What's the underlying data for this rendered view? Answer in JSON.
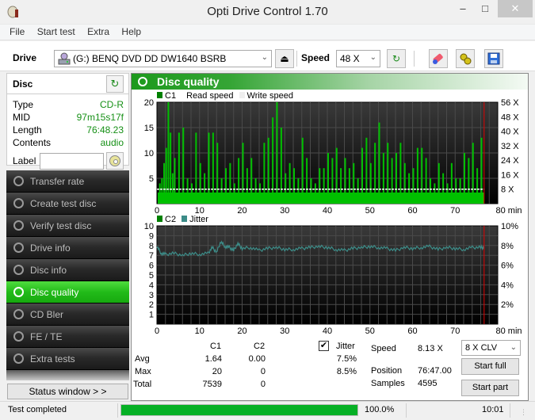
{
  "window": {
    "title": "Opti Drive Control 1.70",
    "controls": {
      "minimize": "–",
      "maximize": "□",
      "close": "✕"
    }
  },
  "menu": [
    "File",
    "Start test",
    "Extra",
    "Help"
  ],
  "toolbar": {
    "drive_label": "Drive",
    "drive_value": "(G:)   BENQ DVD DD DW1640 BSRB",
    "speed_label": "Speed",
    "speed_value": "48 X",
    "icons": [
      "drive-icon",
      "eject-icon",
      "refresh-icon",
      "eraser-icon",
      "options-icon",
      "save-icon"
    ]
  },
  "disc": {
    "header": "Disc",
    "rows": [
      {
        "key": "Type",
        "value": "CD-R"
      },
      {
        "key": "MID",
        "value": "97m15s17f"
      },
      {
        "key": "Length",
        "value": "76:48.23"
      },
      {
        "key": "Contents",
        "value": "audio"
      }
    ],
    "label_key": "Label",
    "label_value": ""
  },
  "nav": {
    "items": [
      {
        "label": "Transfer rate",
        "active": false
      },
      {
        "label": "Create test disc",
        "active": false
      },
      {
        "label": "Verify test disc",
        "active": false
      },
      {
        "label": "Drive info",
        "active": false
      },
      {
        "label": "Disc info",
        "active": false
      },
      {
        "label": "Disc quality",
        "active": true
      },
      {
        "label": "CD Bler",
        "active": false
      },
      {
        "label": "FE / TE",
        "active": false
      },
      {
        "label": "Extra tests",
        "active": false
      }
    ],
    "status_window_button": "Status window > >"
  },
  "main": {
    "title": "Disc quality",
    "legend_top": {
      "c1": "C1",
      "read": "Read speed",
      "write": "Write speed"
    },
    "legend_bottom": {
      "c2": "C2",
      "jitter": "Jitter"
    },
    "stats": {
      "col_c1": "C1",
      "col_c2": "C2",
      "jitter_label": "Jitter",
      "jitter_checked": true,
      "rows": [
        {
          "label": "Avg",
          "c1": "1.64",
          "c2": "0.00",
          "jitter": "7.5%"
        },
        {
          "label": "Max",
          "c1": "20",
          "c2": "0",
          "jitter": "8.5%"
        },
        {
          "label": "Total",
          "c1": "7539",
          "c2": "0",
          "jitter": ""
        }
      ],
      "speed_label": "Speed",
      "speed_value": "8.13 X",
      "position_label": "Position",
      "position_value": "76:47.00",
      "samples_label": "Samples",
      "samples_value": "4595",
      "speed_mode": "8 X CLV",
      "start_full": "Start full",
      "start_part": "Start part"
    }
  },
  "statusbar": {
    "text": "Test completed",
    "progress": 100,
    "progress_text": "100.0%",
    "time": "10:01"
  },
  "colors": {
    "c1": "#00c000",
    "c1_legend": "#008000",
    "jitter": "#3c8c88",
    "end_marker": "#e00000",
    "read_speed": "#ffffff",
    "accent": "#1d9a1d"
  },
  "chart_data": [
    {
      "type": "bar",
      "title": "C1 / Read speed",
      "xlabel": "min",
      "x_ticks": [
        "0",
        "10",
        "20",
        "30",
        "40",
        "50",
        "60",
        "70",
        "80 min"
      ],
      "y_ticks_left": [
        "5",
        "10",
        "15",
        "20"
      ],
      "y_ticks_right": [
        "8 X",
        "16 X",
        "24 X",
        "32 X",
        "40 X",
        "48 X",
        "56 X"
      ],
      "xlim": [
        0,
        80
      ],
      "ylim": [
        0,
        20
      ],
      "y2lim": [
        0,
        56
      ],
      "end_position_min": 76.8,
      "read_speed_x": 8,
      "series": [
        {
          "name": "C1",
          "peaks": [
            [
              0.5,
              4
            ],
            [
              1,
              5
            ],
            [
              1.5,
              8
            ],
            [
              2,
              11
            ],
            [
              2.5,
              20
            ],
            [
              3,
              14
            ],
            [
              3.5,
              6
            ],
            [
              4,
              9
            ],
            [
              5,
              14
            ],
            [
              6,
              15
            ],
            [
              7,
              5
            ],
            [
              8,
              4
            ],
            [
              9,
              14
            ],
            [
              10,
              8
            ],
            [
              11,
              6
            ],
            [
              12,
              14
            ],
            [
              13,
              14
            ],
            [
              14,
              12
            ],
            [
              15,
              5
            ],
            [
              16,
              7
            ],
            [
              17,
              8
            ],
            [
              18,
              4
            ],
            [
              19,
              9
            ],
            [
              20,
              12
            ],
            [
              21,
              7
            ],
            [
              22,
              9
            ],
            [
              23,
              5
            ],
            [
              24,
              4
            ],
            [
              25,
              12
            ],
            [
              26,
              13
            ],
            [
              27,
              17
            ],
            [
              28,
              20
            ],
            [
              29,
              15
            ],
            [
              30,
              6
            ],
            [
              31,
              8
            ],
            [
              32,
              7
            ],
            [
              33,
              5
            ],
            [
              34,
              13
            ],
            [
              35,
              9
            ],
            [
              36,
              5
            ],
            [
              37,
              4
            ],
            [
              38,
              7
            ],
            [
              39,
              7
            ],
            [
              40,
              10
            ],
            [
              41,
              9
            ],
            [
              42,
              11
            ],
            [
              43,
              7
            ],
            [
              44,
              9
            ],
            [
              45,
              7
            ],
            [
              46,
              8
            ],
            [
              47,
              5
            ],
            [
              48,
              11
            ],
            [
              49,
              13
            ],
            [
              50,
              8
            ],
            [
              51,
              12
            ],
            [
              52,
              16
            ],
            [
              53,
              10
            ],
            [
              54,
              12
            ],
            [
              55,
              9
            ],
            [
              56,
              10
            ],
            [
              57,
              12
            ],
            [
              58,
              8
            ],
            [
              59,
              6
            ],
            [
              60,
              7
            ],
            [
              61,
              11
            ],
            [
              62,
              11
            ],
            [
              63,
              9
            ],
            [
              64,
              5
            ],
            [
              65,
              4
            ],
            [
              66,
              8
            ],
            [
              67,
              6
            ],
            [
              68,
              4
            ],
            [
              69,
              8
            ],
            [
              70,
              5
            ],
            [
              71,
              5
            ],
            [
              72,
              10
            ],
            [
              73,
              9
            ],
            [
              74,
              12
            ],
            [
              75,
              7
            ],
            [
              76,
              13
            ]
          ]
        },
        {
          "name": "Read speed",
          "value_x": 8
        }
      ]
    },
    {
      "type": "line",
      "title": "C2 / Jitter",
      "xlabel": "min",
      "x_ticks": [
        "0",
        "10",
        "20",
        "30",
        "40",
        "50",
        "60",
        "70",
        "80 min"
      ],
      "y_ticks_left": [
        "1",
        "2",
        "3",
        "4",
        "5",
        "6",
        "7",
        "8",
        "9",
        "10"
      ],
      "y_ticks_right": [
        "2%",
        "4%",
        "6%",
        "8%",
        "10%"
      ],
      "xlim": [
        0,
        80
      ],
      "ylim": [
        0,
        10
      ],
      "y2lim": [
        0,
        10
      ],
      "end_position_min": 76.8,
      "series": [
        {
          "name": "C2",
          "values": [
            0
          ]
        },
        {
          "name": "Jitter",
          "x": [
            0,
            1,
            2,
            4,
            6,
            8,
            10,
            12,
            13,
            14,
            15,
            16,
            17,
            18,
            19,
            20,
            22,
            24,
            26,
            28,
            30,
            32,
            34,
            36,
            38,
            40,
            42,
            44,
            46,
            48,
            50,
            52,
            54,
            56,
            58,
            60,
            62,
            64,
            66,
            68,
            70,
            72,
            74,
            76,
            76.8
          ],
          "values": [
            7.9,
            7.2,
            7.1,
            7.2,
            7.0,
            7.2,
            7.1,
            7.2,
            7.8,
            7.3,
            8.4,
            7.9,
            7.8,
            7.5,
            8.2,
            7.7,
            7.8,
            7.5,
            7.7,
            7.8,
            7.6,
            7.6,
            7.7,
            7.8,
            7.9,
            7.8,
            7.6,
            7.5,
            7.7,
            7.8,
            7.9,
            7.8,
            7.7,
            7.5,
            7.8,
            7.7,
            7.8,
            7.9,
            7.6,
            7.8,
            7.7,
            7.6,
            7.8,
            7.8,
            7.8
          ]
        }
      ]
    }
  ]
}
